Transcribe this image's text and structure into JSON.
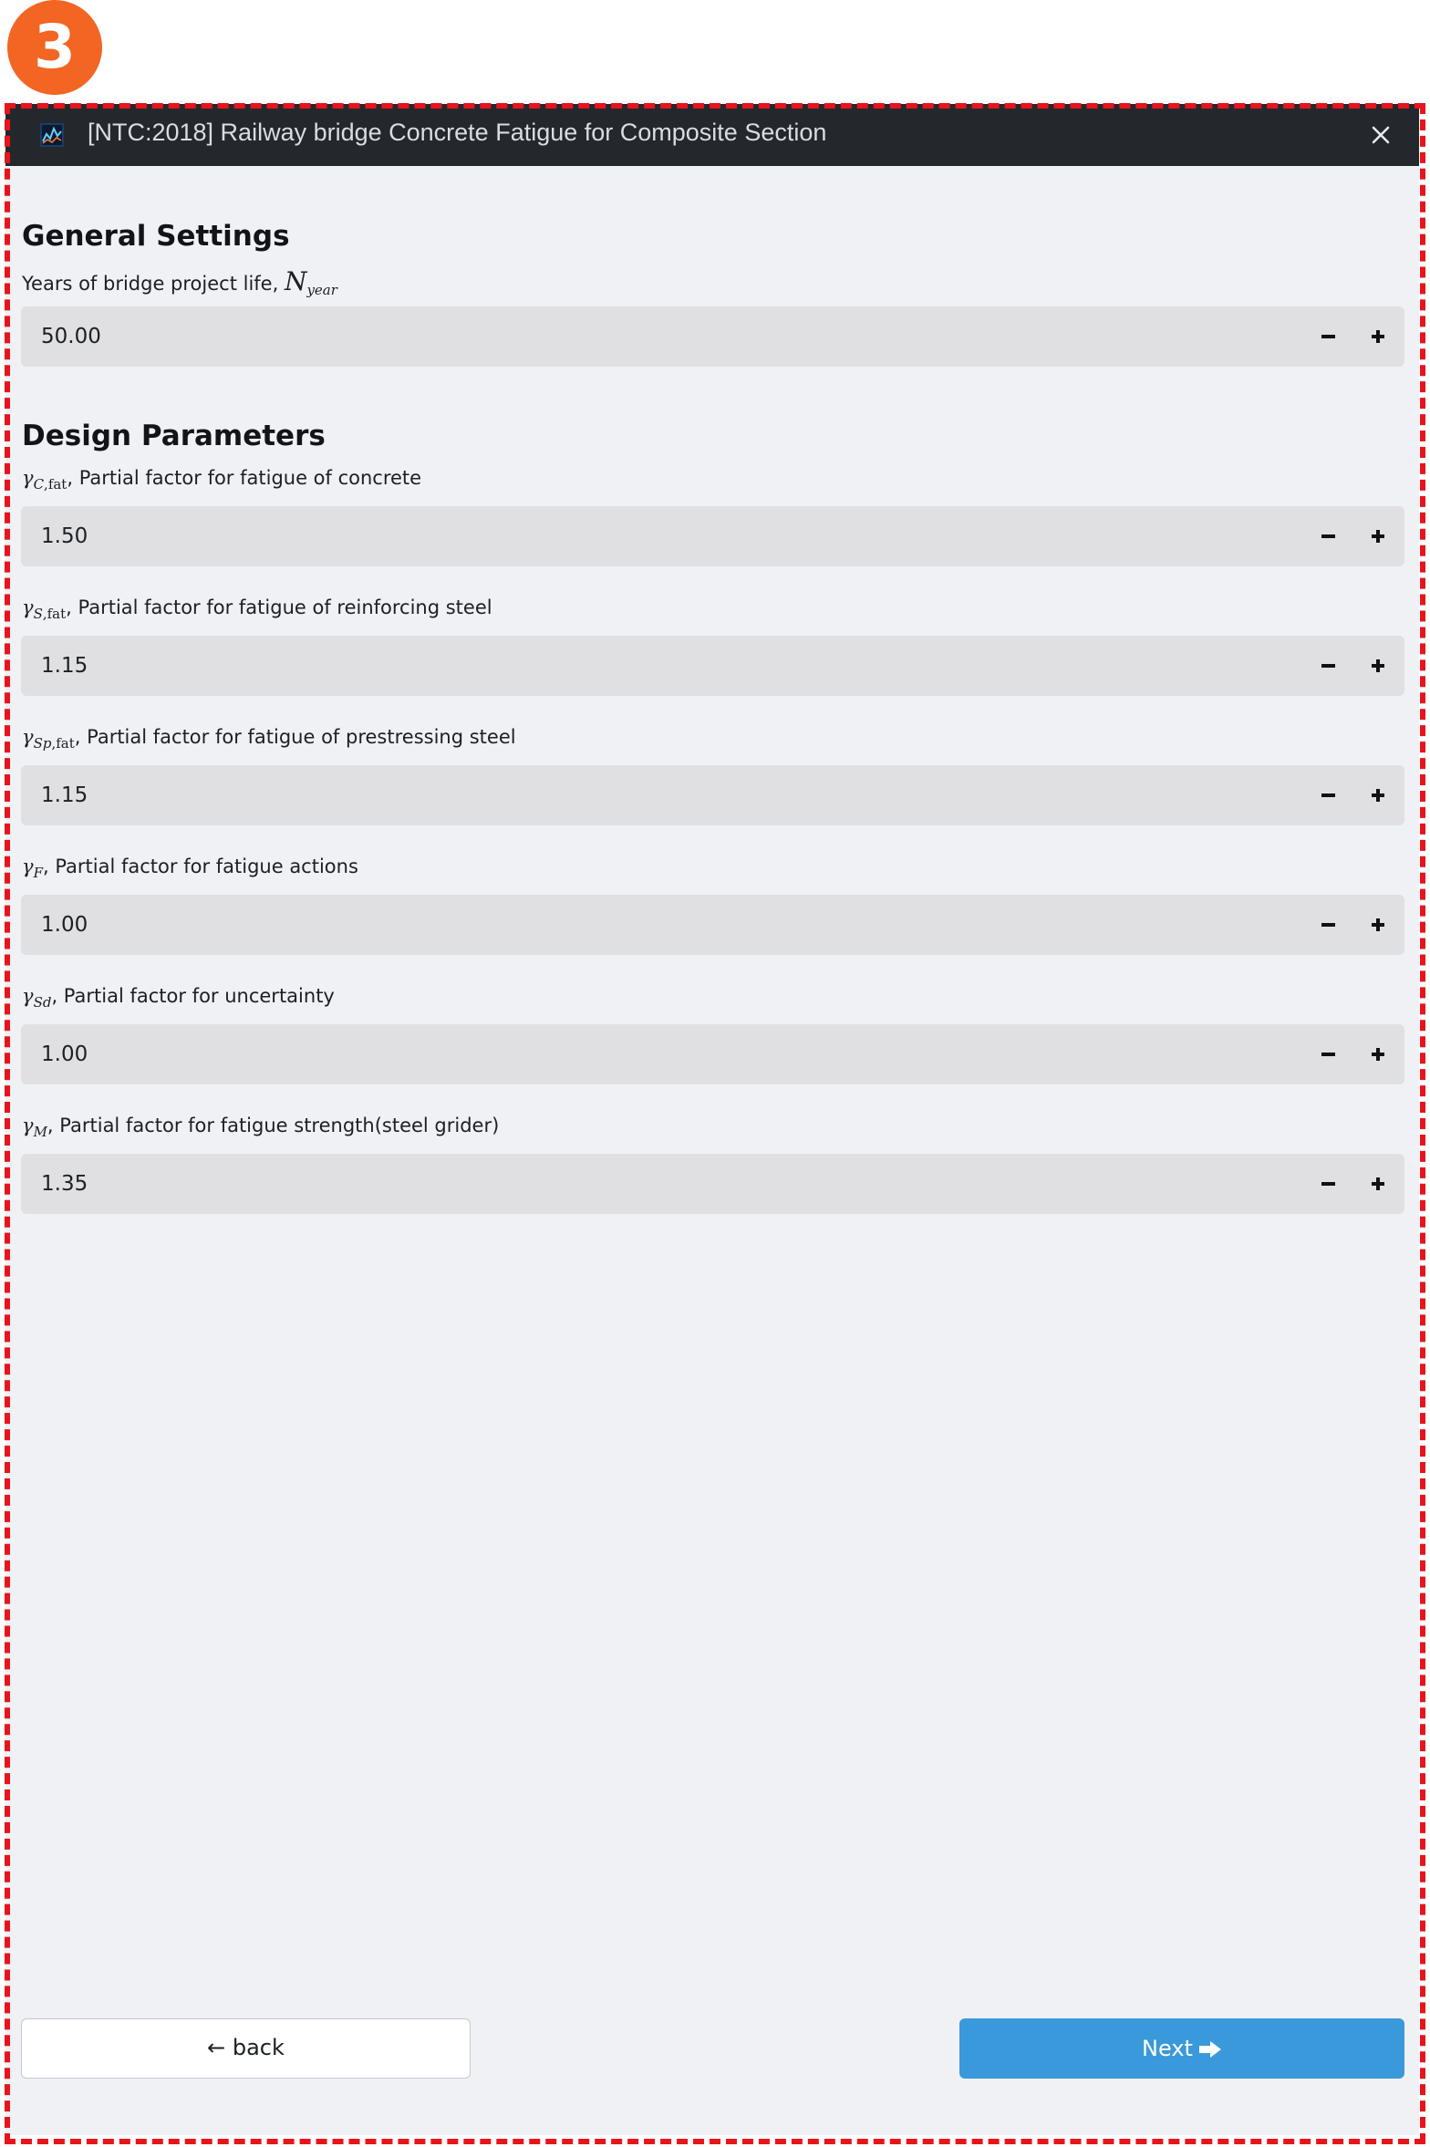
{
  "step_badge": "3",
  "window": {
    "title": "[NTC:2018] Railway bridge Concrete Fatigue for Composite Section",
    "app_icon": "chart-app-icon",
    "close_icon": "close-icon"
  },
  "general": {
    "heading": "General Settings",
    "project_life": {
      "label_text": "Years of bridge project life,",
      "symbol": "N",
      "symbol_sub": "year",
      "value": "50.00"
    }
  },
  "design": {
    "heading": "Design Parameters",
    "fields": [
      {
        "sym": "γ",
        "sub_italic": "C",
        "sub_upright": ",fat",
        "label_text": ", Partial factor for fatigue of concrete",
        "value": "1.50"
      },
      {
        "sym": "γ",
        "sub_italic": "S",
        "sub_upright": ",fat",
        "label_text": ", Partial factor for fatigue of reinforcing steel",
        "value": "1.15"
      },
      {
        "sym": "γ",
        "sub_italic": "Sp",
        "sub_upright": ",fat",
        "label_text": ", Partial factor for fatigue of prestressing steel",
        "value": "1.15"
      },
      {
        "sym": "γ",
        "sub_italic": "F",
        "sub_upright": "",
        "label_text": ", Partial factor for fatigue actions",
        "value": "1.00"
      },
      {
        "sym": "γ",
        "sub_italic": "Sd",
        "sub_upright": "",
        "label_text": ", Partial factor for uncertainty",
        "value": "1.00"
      },
      {
        "sym": "γ",
        "sub_italic": "M",
        "sub_upright": "",
        "label_text": ", Partial factor for fatigue strength(steel grider)",
        "value": "1.35"
      }
    ]
  },
  "stepper": {
    "minus_icon": "minus-icon",
    "plus_icon": "plus-icon"
  },
  "footer": {
    "back_label": "← back",
    "next_label": "Next",
    "next_icon": "arrow-right-icon"
  },
  "colors": {
    "badge": "#f26522",
    "dashed_frame": "#e8141b",
    "titlebar": "#24282d",
    "panel": "#f0f1f4",
    "input": "#e0e0e2",
    "primary": "#3a99db"
  }
}
